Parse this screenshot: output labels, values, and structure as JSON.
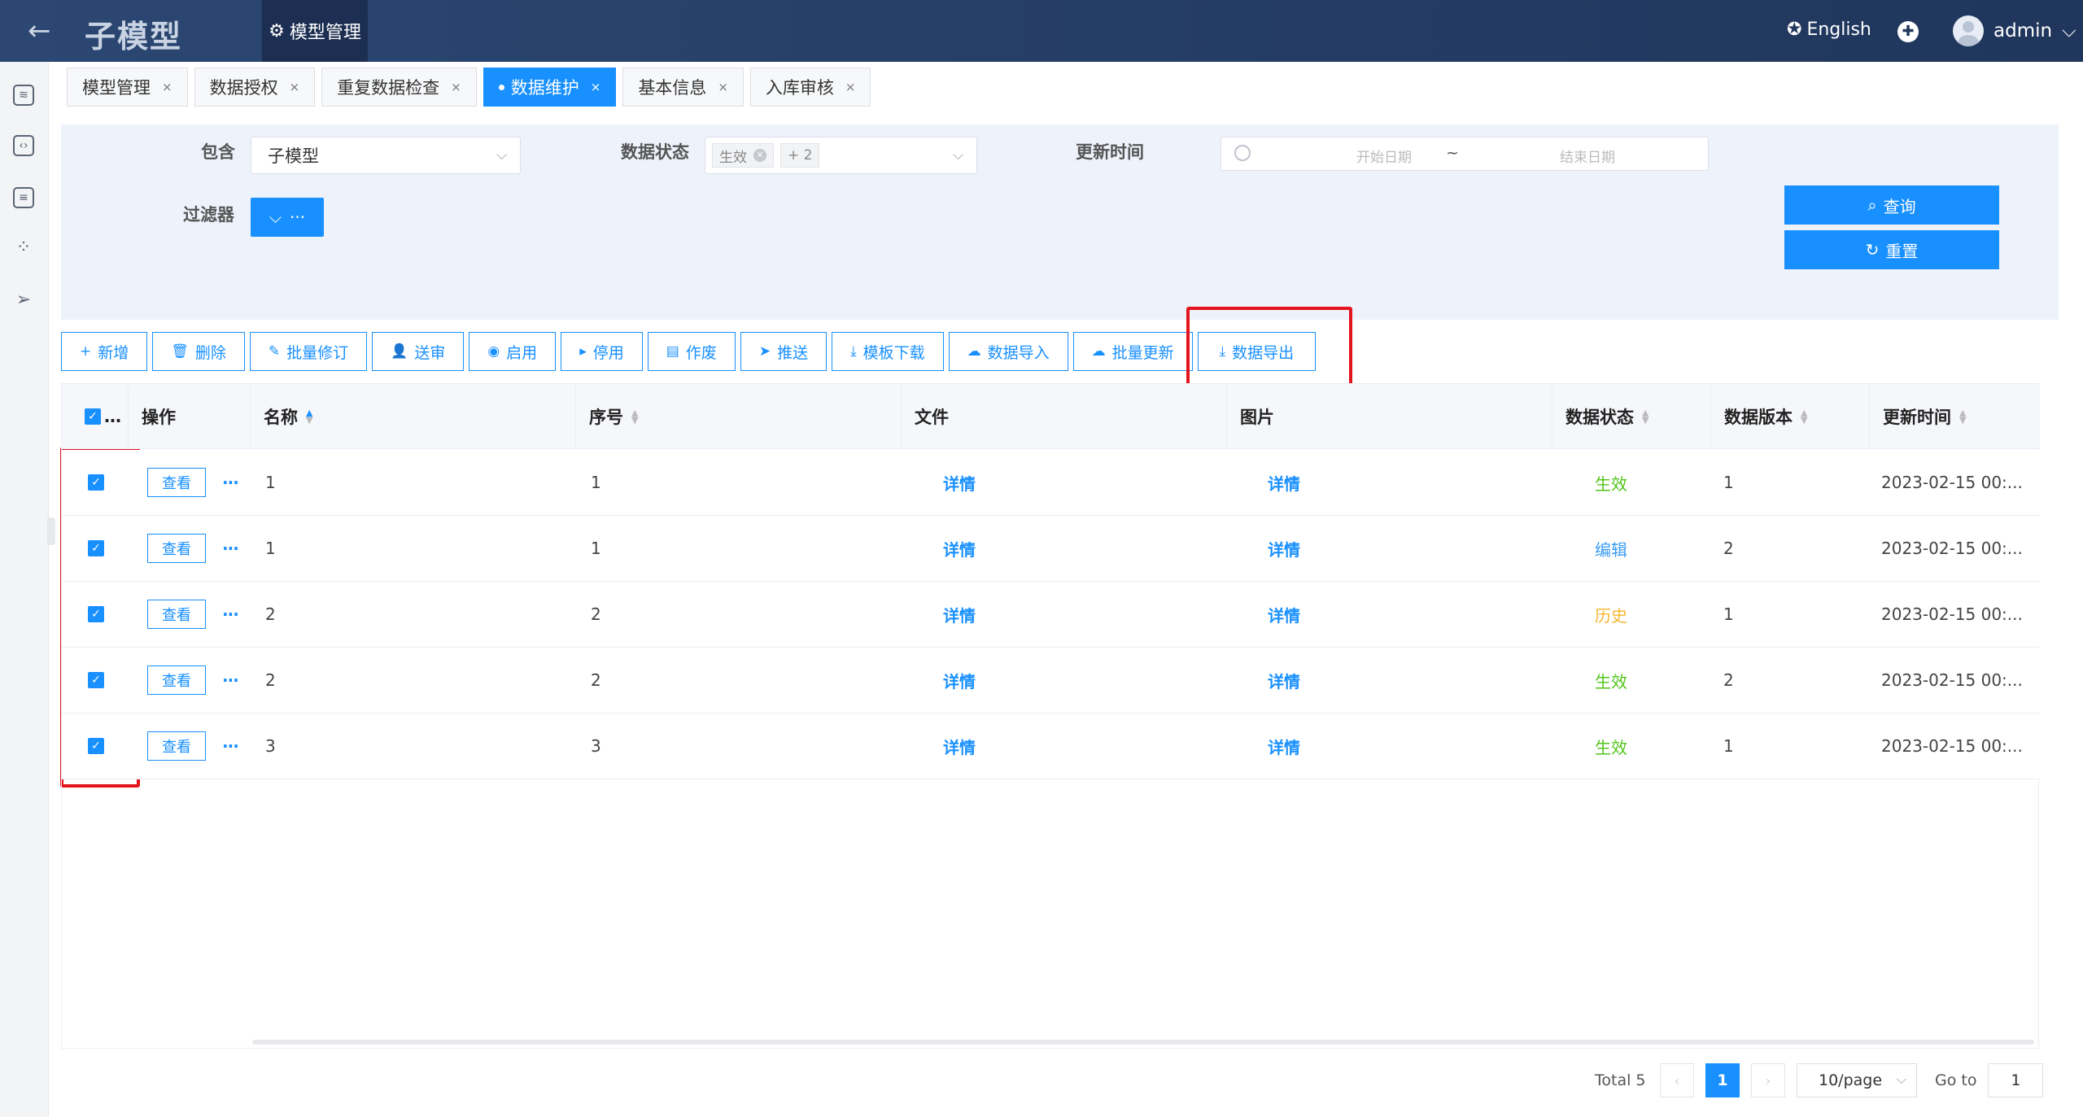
{
  "header": {
    "title": "子模型",
    "active_tab": "模型管理",
    "language": "English",
    "user": "admin"
  },
  "tabs": [
    {
      "label": "模型管理",
      "active": false
    },
    {
      "label": "数据授权",
      "active": false
    },
    {
      "label": "重复数据检查",
      "active": false
    },
    {
      "label": "数据维护",
      "active": true
    },
    {
      "label": "基本信息",
      "active": false
    },
    {
      "label": "入库审核",
      "active": false
    }
  ],
  "tab_close": "×",
  "filters": {
    "contains_label": "包含",
    "contains_value": "子模型",
    "status_label": "数据状态",
    "status_chip": "生效",
    "status_more": "+ 2",
    "update_label": "更新时间",
    "date_start_placeholder": "开始日期",
    "date_separator": "~",
    "date_end_placeholder": "结束日期",
    "filter_label": "过滤器",
    "filter_button": "···",
    "query_button": "查询",
    "reset_button": "重置"
  },
  "toolbar": [
    {
      "label": "新增",
      "icon": "plus-icon",
      "glyph": "+"
    },
    {
      "label": "删除",
      "icon": "trash-icon",
      "glyph": "🗑"
    },
    {
      "label": "批量修订",
      "icon": "edit-icon",
      "glyph": "✎"
    },
    {
      "label": "送审",
      "icon": "user-icon",
      "glyph": "👤"
    },
    {
      "label": "启用",
      "icon": "play-circle-icon",
      "glyph": "◉"
    },
    {
      "label": "停用",
      "icon": "caret-right-icon",
      "glyph": "▸"
    },
    {
      "label": "作废",
      "icon": "file-icon",
      "glyph": "▤"
    },
    {
      "label": "推送",
      "icon": "send-icon",
      "glyph": "➤"
    },
    {
      "label": "模板下载",
      "icon": "download-icon",
      "glyph": "⤓"
    },
    {
      "label": "数据导入",
      "icon": "cloud-upload-icon",
      "glyph": "☁"
    },
    {
      "label": "批量更新",
      "icon": "cloud-upload-icon",
      "glyph": "☁"
    },
    {
      "label": "数据导出",
      "icon": "download-icon",
      "glyph": "⤓"
    }
  ],
  "table": {
    "select_all_label": "…",
    "columns": {
      "action": "操作",
      "name": "名称",
      "seq": "序号",
      "file": "文件",
      "image": "图片",
      "status": "数据状态",
      "version": "数据版本",
      "updated": "更新时间"
    },
    "view_label": "查看",
    "more_label": "···",
    "rows": [
      {
        "name": "1",
        "seq": "1",
        "file": "详情",
        "image": "详情",
        "status": "生效",
        "status_color": "#52c41a",
        "version": "1",
        "updated": "2023-02-15 00:..."
      },
      {
        "name": "1",
        "seq": "1",
        "file": "详情",
        "image": "详情",
        "status": "编辑",
        "status_color": "#3b9cf0",
        "version": "2",
        "updated": "2023-02-15 00:..."
      },
      {
        "name": "2",
        "seq": "2",
        "file": "详情",
        "image": "详情",
        "status": "历史",
        "status_color": "#f5b731",
        "version": "1",
        "updated": "2023-02-15 00:..."
      },
      {
        "name": "2",
        "seq": "2",
        "file": "详情",
        "image": "详情",
        "status": "生效",
        "status_color": "#52c41a",
        "version": "2",
        "updated": "2023-02-15 00:..."
      },
      {
        "name": "3",
        "seq": "3",
        "file": "详情",
        "image": "详情",
        "status": "生效",
        "status_color": "#52c41a",
        "version": "1",
        "updated": "2023-02-15 00:..."
      }
    ]
  },
  "pagination": {
    "total": "Total 5",
    "current_page": "1",
    "page_size": "10/page",
    "goto_label": "Go to",
    "goto_value": "1"
  }
}
